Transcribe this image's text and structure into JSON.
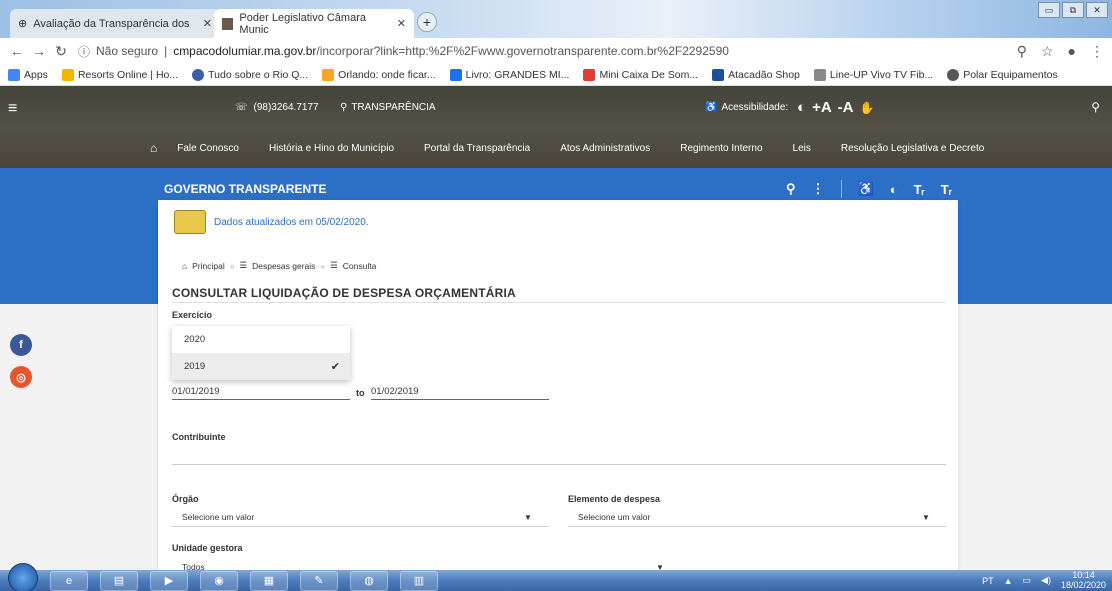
{
  "browser": {
    "tabs": [
      {
        "label": "Avaliação da Transparência dos"
      },
      {
        "label": "Poder Legislativo Câmara Munic"
      }
    ],
    "new_tab": "+",
    "security": "Não seguro",
    "url_domain": "cmpacodolumiar.ma.gov.br",
    "url_path": "/incorporar?link=http:%2F%2Fwww.governotransparente.com.br%2F2292590",
    "bookmarks": [
      {
        "label": "Apps",
        "color": "#4285f4"
      },
      {
        "label": "Resorts Online | Ho...",
        "color": "#f4b400"
      },
      {
        "label": "Tudo sobre o Rio Q...",
        "color": "#3a5fa8"
      },
      {
        "label": "Orlando: onde ficar...",
        "color": "#f5a623"
      },
      {
        "label": "Livro: GRANDES MI...",
        "color": "#1a73e8"
      },
      {
        "label": "Mini Caixa De Som...",
        "color": "#e03c31"
      },
      {
        "label": "Atacadão Shop",
        "color": "#1f4e9b"
      },
      {
        "label": "Line-UP Vivo TV Fib...",
        "color": "#888888"
      },
      {
        "label": "Polar Equipamentos",
        "color": "#555555"
      }
    ]
  },
  "site": {
    "phone": "(98)3264.7177",
    "transparencia": "TRANSPARÊNCIA",
    "acessibilidade": "Acessibilidade:",
    "font_plus": "+A",
    "font_minus": "-A",
    "menu": [
      "Fale Conosco",
      "História e Hino do Município",
      "Portal da Transparência",
      "Atos Administrativos",
      "Regimento Interno",
      "Leis",
      "Resolução Legislativa e Decreto"
    ]
  },
  "gt": {
    "title": "GOVERNO TRANSPARENTE"
  },
  "card": {
    "updated": "Dados atualizados em 05/02/2020.",
    "breadcrumb": [
      "Principal",
      "Despesas gerais",
      "Consulta"
    ],
    "title": "CONSULTAR LIQUIDAÇÃO DE DESPESA ORÇAMENTÁRIA",
    "exercicio_label": "Exercício",
    "exercicio_options": [
      "2020",
      "2019"
    ],
    "exercicio_selected": "2019",
    "date_from": "01/01/2019",
    "date_to_label": "to",
    "date_to": "01/02/2019",
    "contribuinte_label": "Contribuinte",
    "orgao_label": "Órgão",
    "orgao_value": "Selecione um valor",
    "elemento_label": "Elemento de despesa",
    "elemento_value": "Selecione um valor",
    "unidade_label": "Unidade gestora",
    "unidade_value": "Todos"
  },
  "taskbar": {
    "lang": "PT",
    "time": "10:14",
    "date": "18/02/2020"
  },
  "colors": {
    "brand_blue": "#2b6fc6",
    "facebook": "#3b5998",
    "instagram": "#e8552d"
  }
}
